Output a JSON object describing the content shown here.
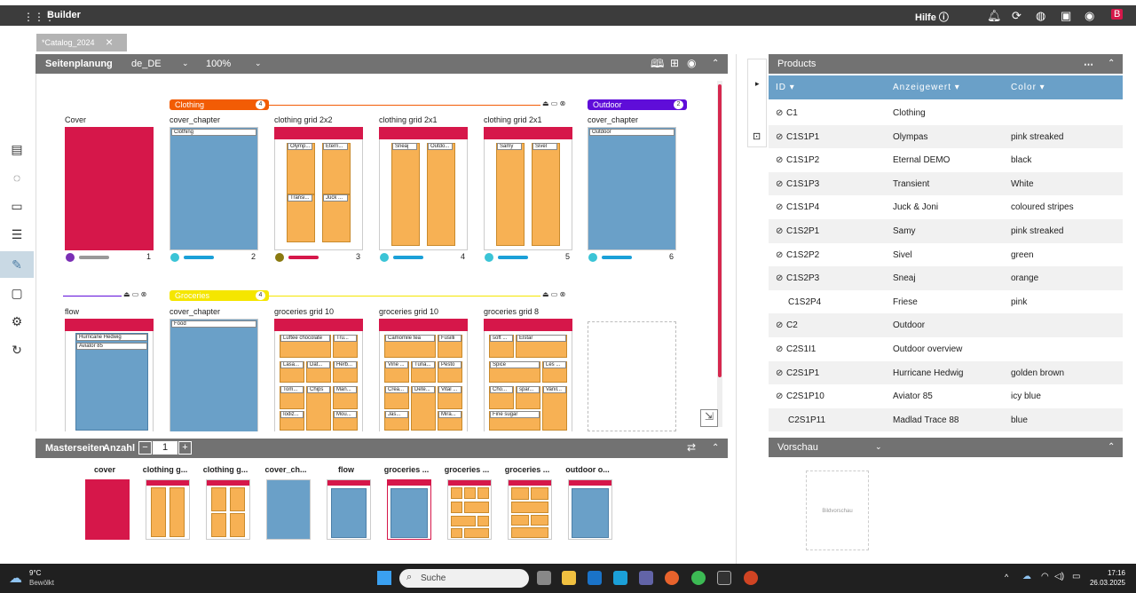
{
  "app": {
    "title": "Builder",
    "help_label": "Hilfe"
  },
  "doc_tab": {
    "label": "*Catalog_2024"
  },
  "planning": {
    "title": "Seitenplanung",
    "locale": "de_DE",
    "zoom": "100%",
    "chapters": [
      {
        "label": "Clothing",
        "count": "4",
        "color": "#f25c05"
      },
      {
        "label": "Outdoor",
        "count": "2",
        "color": "#5f0dd9"
      },
      {
        "label": "Groceries",
        "count": "4",
        "color": "#f5e600"
      }
    ],
    "row1": [
      {
        "title": "Cover",
        "num": "1",
        "kind": "cover"
      },
      {
        "title": "cover_chapter",
        "num": "2",
        "kind": "chapter",
        "field": "Clothing"
      },
      {
        "title": "clothing grid 2x2",
        "num": "3",
        "kind": "grid2x2",
        "fields": [
          "Olymp...",
          "Etern...",
          "Transi...",
          "Juck ..."
        ]
      },
      {
        "title": "clothing grid 2x1",
        "num": "4",
        "kind": "grid2x1",
        "fields": [
          "Sneaj",
          "Outdo..."
        ]
      },
      {
        "title": "clothing grid 2x1",
        "num": "5",
        "kind": "grid2x1",
        "fields": [
          "Samy",
          "Sivel"
        ]
      },
      {
        "title": "cover_chapter",
        "num": "6",
        "kind": "chapter",
        "field": "Outdoor"
      }
    ],
    "row2": [
      {
        "title": "flow",
        "kind": "flow",
        "fields": [
          "Hurricane Hedwig",
          "Aviator 85"
        ]
      },
      {
        "title": "cover_chapter",
        "kind": "chapter",
        "field": "Food"
      },
      {
        "title": "groceries grid 10",
        "kind": "grocA",
        "fields": [
          "Luftée chocolate",
          "Tru...",
          "Lasa...",
          "Dat...",
          "Herb...",
          "Tom...",
          "Chips",
          "Man...",
          "Iodiz...",
          "Mou..."
        ]
      },
      {
        "title": "groceries grid 10",
        "kind": "grocB",
        "fields": [
          "Camomile tea",
          "Fusilli",
          "Vine ...",
          "Tuna...",
          "Pesto",
          "Crea...",
          "Dete...",
          "Vital ...",
          "Jas...",
          "Mira..."
        ]
      },
      {
        "title": "groceries grid 8",
        "kind": "grocC",
        "fields": [
          "soft ...",
          "Elstar",
          "Spice",
          "Les ...",
          "Cho...",
          "spar...",
          "Vanil...",
          "Fine sugar"
        ]
      }
    ]
  },
  "masters": {
    "title": "Masterseiten",
    "count_label": "Anzahl",
    "count_value": "1",
    "items": [
      "cover",
      "clothing g...",
      "clothing g...",
      "cover_ch...",
      "flow",
      "groceries ...",
      "groceries ...",
      "groceries ...",
      "outdoor o..."
    ]
  },
  "products": {
    "title": "Products",
    "columns": [
      "ID",
      "Anzeigewert",
      "Color"
    ],
    "rows": [
      {
        "id": "C1",
        "name": "Clothing",
        "color": "",
        "check": true
      },
      {
        "id": "C1S1P1",
        "name": "Olympas",
        "color": "pink streaked",
        "check": true
      },
      {
        "id": "C1S1P2",
        "name": "Eternal DEMO",
        "color": "black",
        "check": true
      },
      {
        "id": "C1S1P3",
        "name": "Transient",
        "color": "White",
        "check": true
      },
      {
        "id": "C1S1P4",
        "name": "Juck & Joni",
        "color": "coloured stripes",
        "check": true
      },
      {
        "id": "C1S2P1",
        "name": "Samy",
        "color": "pink streaked",
        "check": true
      },
      {
        "id": "C1S2P2",
        "name": "Sivel",
        "color": "green",
        "check": true
      },
      {
        "id": "C1S2P3",
        "name": "Sneaj",
        "color": "orange",
        "check": true
      },
      {
        "id": "C1S2P4",
        "name": "Friese",
        "color": "pink",
        "check": false
      },
      {
        "id": "C2",
        "name": "Outdoor",
        "color": "",
        "check": true
      },
      {
        "id": "C2S1I1",
        "name": "Outdoor overview",
        "color": "",
        "check": true
      },
      {
        "id": "C2S1P1",
        "name": "Hurricane Hedwig",
        "color": "golden brown",
        "check": true
      },
      {
        "id": "C2S1P10",
        "name": "Aviator 85",
        "color": "icy blue",
        "check": true
      },
      {
        "id": "C2S1P11",
        "name": "Madlad Trace 88",
        "color": "blue",
        "check": false
      }
    ]
  },
  "preview": {
    "title": "Vorschau",
    "placeholder": "Bildvorschau"
  },
  "taskbar": {
    "temp": "9°C",
    "weather": "Bewölkt",
    "search": "Suche",
    "time": "17:16",
    "date": "26.03.2025"
  },
  "colors": {
    "red": "#d6174a",
    "blue": "#6aa0c8",
    "orange": "#f7b154",
    "dark": "#3c3c3c"
  }
}
